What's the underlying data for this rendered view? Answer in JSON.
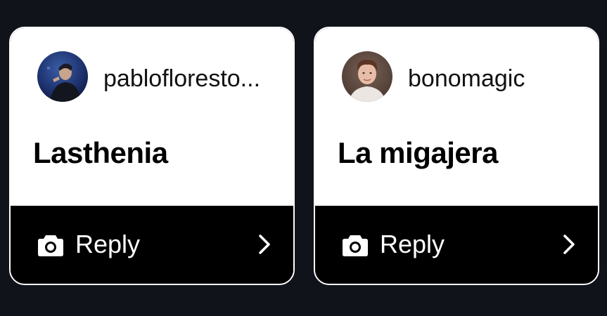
{
  "cards": [
    {
      "username": "pablofloresto...",
      "prompt": "Lasthenia",
      "reply_label": "Reply",
      "avatar_icon": "user-avatar-photo",
      "action_icon": "camera-icon",
      "arrow_icon": "chevron-right-icon"
    },
    {
      "username": "bonomagic",
      "prompt": "La migajera",
      "reply_label": "Reply",
      "avatar_icon": "user-avatar-photo",
      "action_icon": "camera-icon",
      "arrow_icon": "chevron-right-icon"
    }
  ],
  "colors": {
    "background": "#10141a",
    "card_top": "#ffffff",
    "reply_bar": "#000000",
    "card_border": "#ffffff"
  }
}
